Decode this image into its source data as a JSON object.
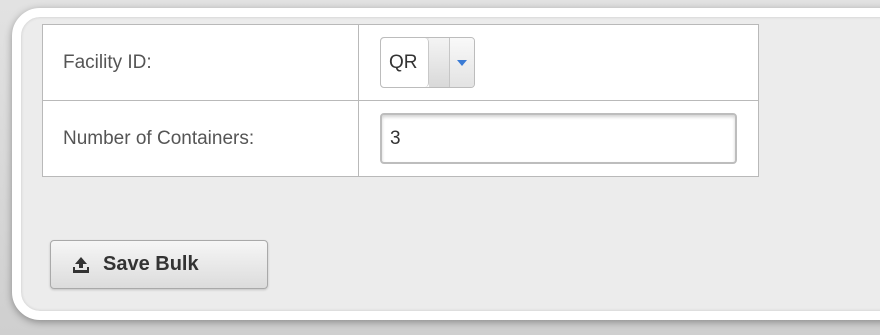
{
  "form": {
    "facility": {
      "label": "Facility ID:",
      "selected": "QR"
    },
    "containers": {
      "label": "Number of Containers:",
      "value": "3"
    }
  },
  "actions": {
    "save_label": "Save Bulk",
    "save_icon": "upload-icon"
  },
  "colors": {
    "dropdown_arrow": "#3a7bd5",
    "label_text": "#555555"
  }
}
